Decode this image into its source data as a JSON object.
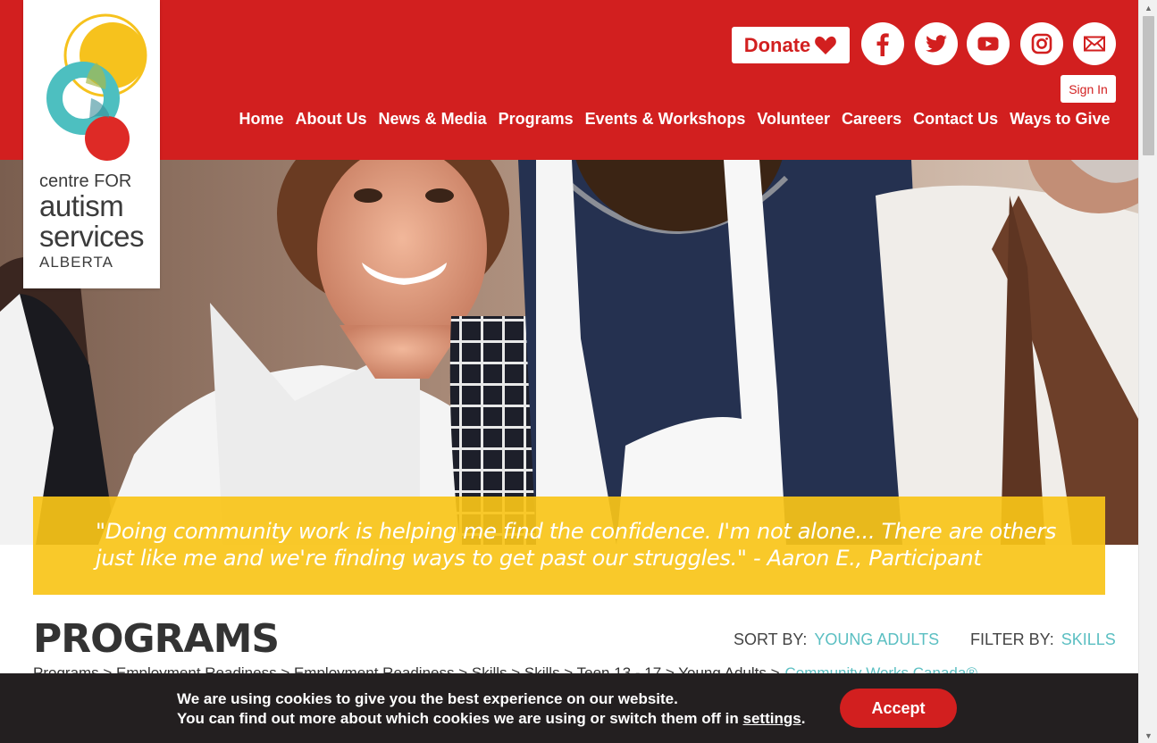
{
  "brand": {
    "logo_line1": "centre FOR",
    "logo_line2": "autism",
    "logo_line3": "services",
    "logo_line4": "ALBERTA",
    "colors": {
      "primary_red": "#d21f1f",
      "yellow": "#f8c418",
      "teal": "#5bbfc2",
      "dark_text": "#333333",
      "cookie_bg": "#231f20"
    }
  },
  "header": {
    "donate_label": "Donate",
    "donate_icon": "heart-icon",
    "social": [
      {
        "name": "facebook",
        "icon": "facebook-icon"
      },
      {
        "name": "twitter",
        "icon": "twitter-icon"
      },
      {
        "name": "youtube",
        "icon": "youtube-icon"
      },
      {
        "name": "instagram",
        "icon": "instagram-icon"
      },
      {
        "name": "email",
        "icon": "mail-icon"
      }
    ],
    "signin_label": "Sign In"
  },
  "nav": {
    "items": [
      "Home",
      "About Us",
      "News & Media",
      "Programs",
      "Events & Workshops",
      "Volunteer",
      "Careers",
      "Contact Us",
      "Ways to Give"
    ]
  },
  "hero": {
    "quote": "\"Doing community work is helping me find the confidence. I'm not alone... There are others just like me and we're finding ways to get past our struggles.\" - Aaron E., Participant"
  },
  "programs": {
    "title": "PROGRAMS",
    "sort_label": "SORT BY:",
    "sort_value": "YOUNG ADULTS",
    "filter_label": "FILTER BY:",
    "filter_value": "SKILLS",
    "crumbs_text": "Programs > Employment Readiness > Employment Readiness > Skills > Skills > Teen 13 - 17 > Young Adults >",
    "crumbs_link": "Community Works Canada®"
  },
  "cookie": {
    "line1": "We are using cookies to give you the best experience on our website.",
    "line2_prefix": "You can find out more about which cookies we are using or switch them off in",
    "settings_link": "settings",
    "line2_suffix": ".",
    "accept_label": "Accept"
  }
}
